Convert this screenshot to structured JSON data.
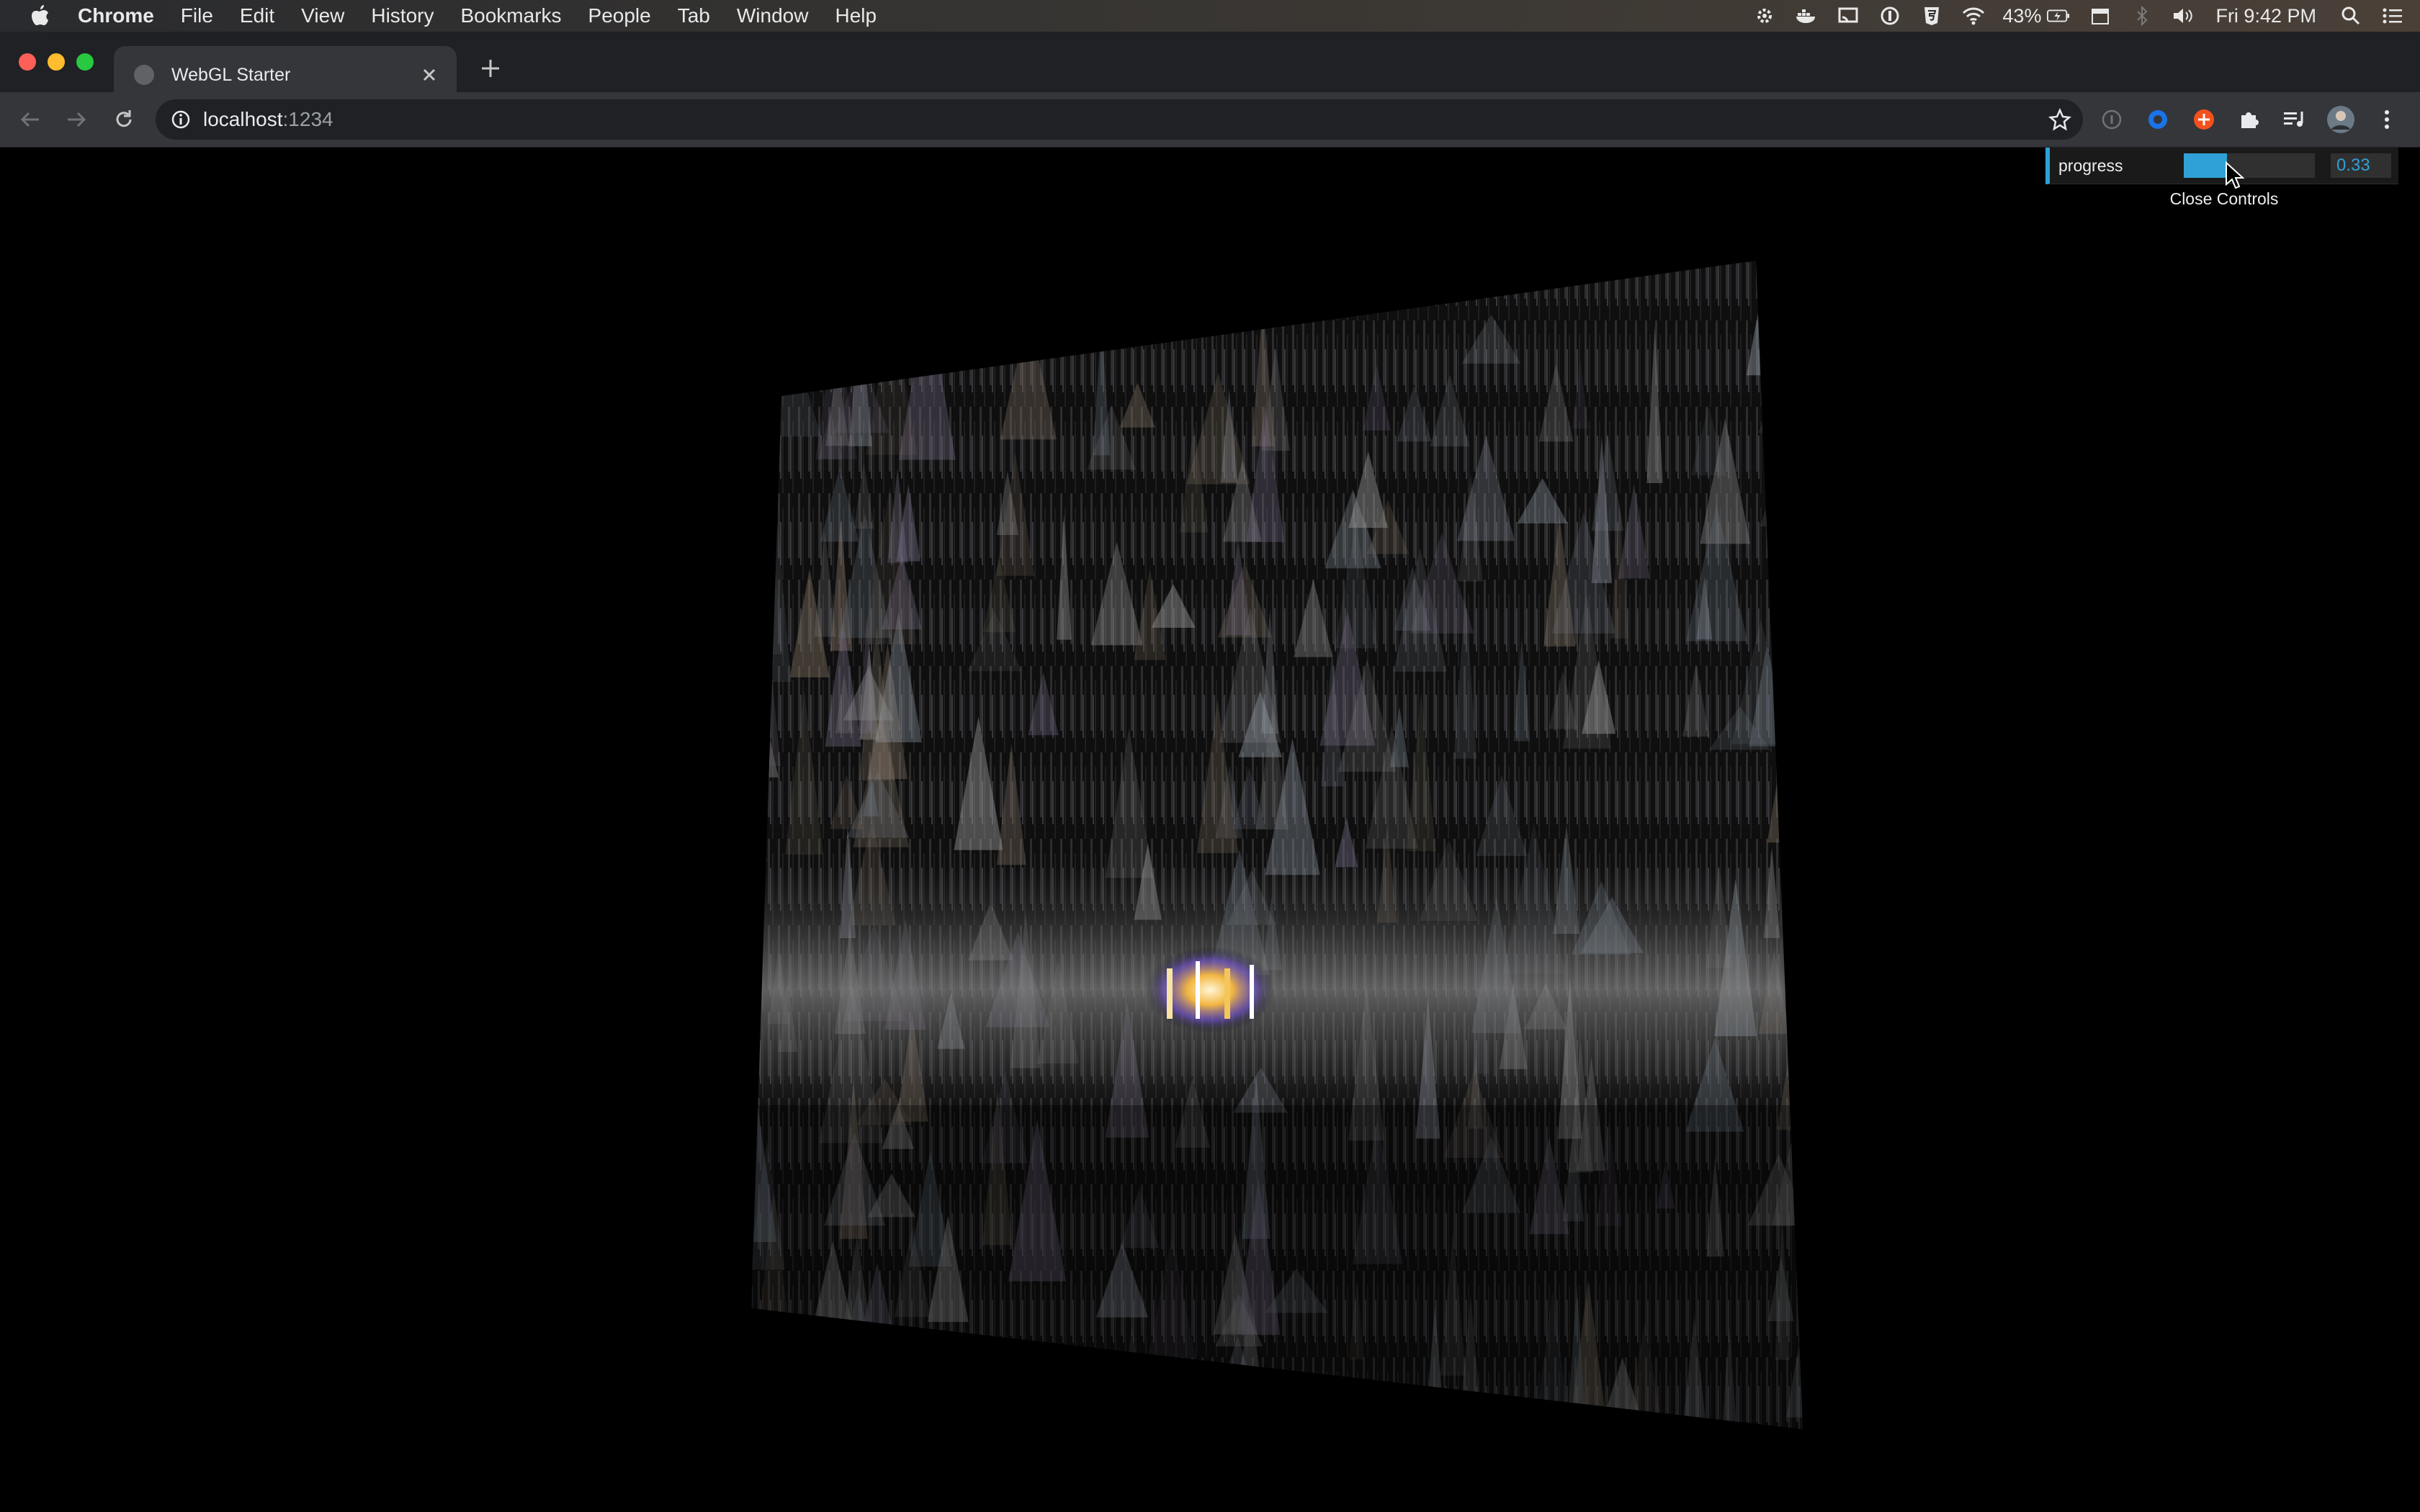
{
  "menubar": {
    "app": "Chrome",
    "items": [
      "File",
      "Edit",
      "View",
      "History",
      "Bookmarks",
      "People",
      "Tab",
      "Window",
      "Help"
    ],
    "battery": "43%",
    "clock": "Fri 9:42 PM"
  },
  "tab": {
    "title": "WebGL Starter"
  },
  "omnibox": {
    "host": "localhost",
    "port": ":1234"
  },
  "gui": {
    "controller_label": "progress",
    "progress_value": 0.33,
    "value_text": "0.33",
    "close_label": "Close Controls"
  },
  "colors": {
    "accent": "#2fa1d6",
    "page_bg": "#000000",
    "chrome_dark": "#202124",
    "chrome_toolbar": "#35363a"
  },
  "icons": [
    "apple-icon",
    "back-icon",
    "forward-icon",
    "reload-icon",
    "info-icon",
    "star-icon",
    "extensions-icon",
    "profile-avatar-icon"
  ]
}
